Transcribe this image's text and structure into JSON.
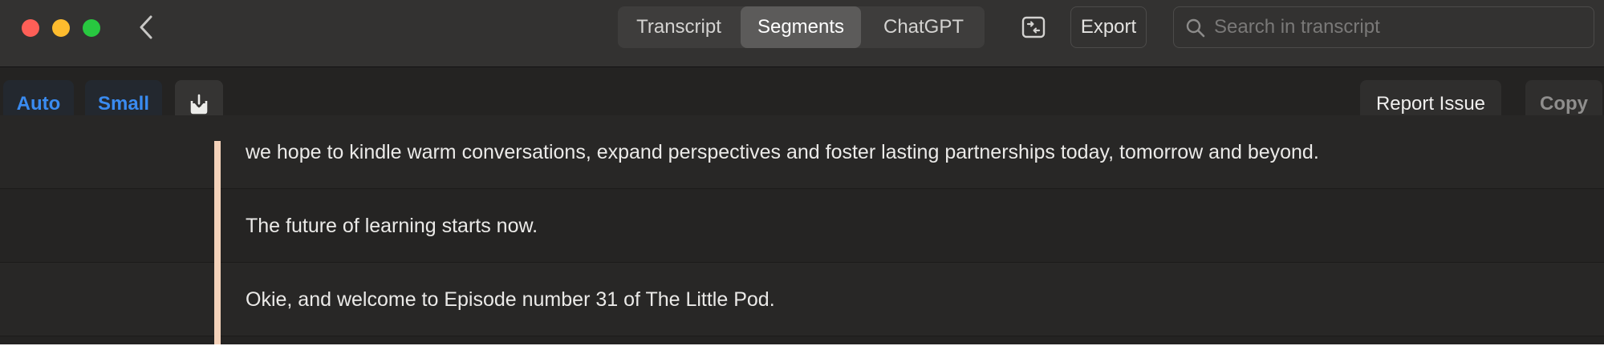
{
  "window": {
    "traffic_lights": [
      "close",
      "minimize",
      "zoom"
    ],
    "back_icon": "chevron-left-icon"
  },
  "view_tabs": {
    "transcript": "Transcript",
    "segments": "Segments",
    "chatgpt": "ChatGPT",
    "selected": "Segments"
  },
  "header": {
    "sidebar_icon": "sidebar-toggle-icon",
    "export_label": "Export",
    "search_placeholder": "Search in transcript",
    "search_value": ""
  },
  "toolbar": {
    "auto_label": "Auto",
    "small_label": "Small",
    "download_icon": "download-tray-icon",
    "report_label": "Report Issue",
    "copy_label": "Copy"
  },
  "segments": [
    "we hope to kindle warm conversations, expand perspectives and foster lasting partnerships today, tomorrow and beyond.",
    "The future of learning starts now.",
    "Okie, and welcome to Episode number 31 of The Little Pod."
  ],
  "colors": {
    "accent_blue": "#3a8bf0",
    "segment_marker": "#f4d2ba",
    "close": "#fe5f57",
    "minimize": "#febc2e",
    "zoom": "#28c840"
  }
}
